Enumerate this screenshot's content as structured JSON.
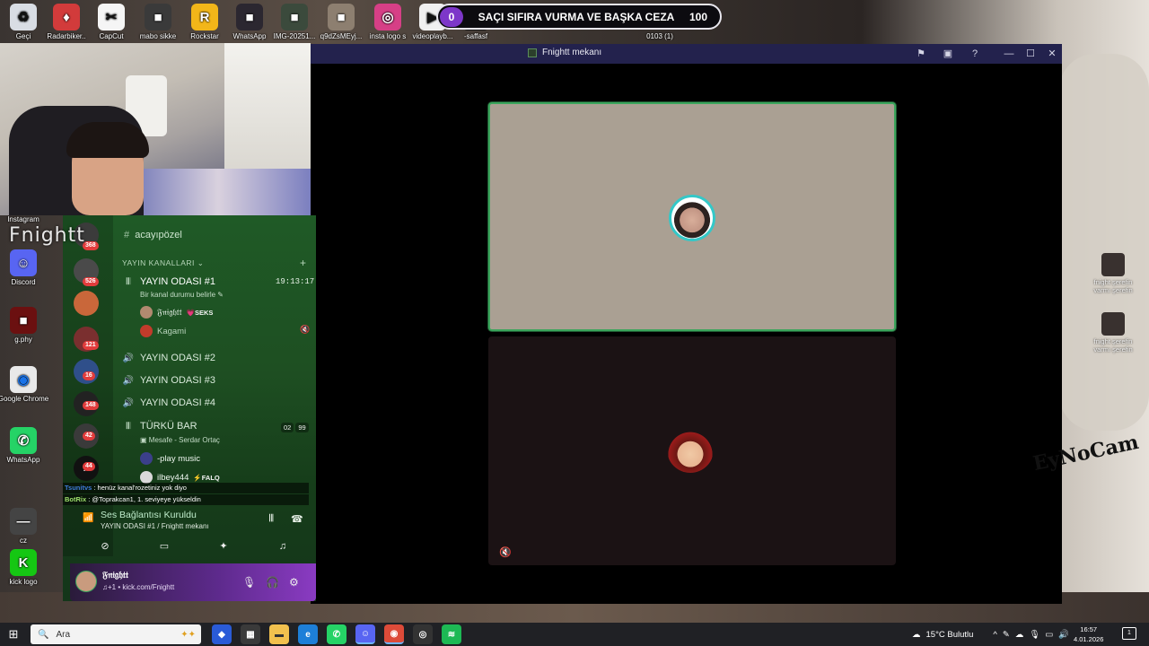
{
  "desktop_icons_top": [
    {
      "label": "Geçi",
      "color": "#d9dde4",
      "glyph": "♻"
    },
    {
      "label": "Radarbiker..",
      "color": "#d23b3b",
      "glyph": "♦"
    },
    {
      "label": "CapCut",
      "color": "#f5f5f5",
      "glyph": "✂"
    },
    {
      "label": "mabo sikke",
      "color": "#3a3a3a",
      "glyph": "■"
    },
    {
      "label": "Rockstar",
      "color": "#f2b619",
      "glyph": "R"
    },
    {
      "label": "WhatsApp",
      "color": "#2b2730",
      "glyph": "■"
    },
    {
      "label": "IMG-20251...",
      "color": "#3b4a3c",
      "glyph": "■"
    },
    {
      "label": "q9dZsMEyj...",
      "color": "#8d7f70",
      "glyph": "■"
    },
    {
      "label": "insta logo s",
      "color": "#d63f86",
      "glyph": "◎"
    },
    {
      "label": "videoplayb...",
      "color": "#f0f0f0",
      "glyph": "▶"
    },
    {
      "label": "-saffasf",
      "color": "#1b1b1b",
      "glyph": "■"
    },
    {
      "label": "0103 (1)",
      "color": "#000000",
      "glyph": ""
    }
  ],
  "desktop_icons_left": [
    {
      "label": "Instagram",
      "color": "#c73a7c",
      "glyph": "◎"
    },
    {
      "label": "Discord",
      "color": "#5865f2",
      "glyph": "☺"
    },
    {
      "label": "g.phy",
      "color": "#6b1010",
      "glyph": "■"
    },
    {
      "label": "Google Chrome",
      "color": "#e9e9e9",
      "glyph": "◉"
    },
    {
      "label": "WhatsApp",
      "color": "#25d366",
      "glyph": "✆"
    },
    {
      "label": "cz",
      "color": "#444444",
      "glyph": "—"
    },
    {
      "label": "kick logo",
      "color": "#15c713",
      "glyph": "K"
    }
  ],
  "score": {
    "left": "0",
    "title": "SAÇI SIFIRA VURMA VE BAŞKA CEZA",
    "right": "100"
  },
  "callwin": {
    "title": "Fnightt mekanı"
  },
  "discord": {
    "streamer": "Fnightt",
    "channel_head": "acayıpözel",
    "category": "YAYIN KANALLARI",
    "active_channel": "YAYIN ODASI #1",
    "timer": "19:13:17",
    "status_hint": "Bir kanal durumu belirle",
    "users_room1": [
      {
        "name": "𝔉𝔫𝔦𝔤𝔥𝔱𝔱",
        "tag": "💗SEKS",
        "color": "#b28a70"
      },
      {
        "name": "Kagami",
        "color": "#c23b2b",
        "tag": ""
      }
    ],
    "channels": [
      "YAYIN ODASI #2",
      "YAYIN ODASI #3",
      "YAYIN ODASI #4"
    ],
    "turku": {
      "name": "TÜRKÜ BAR",
      "sub": "Mesafe - Serdar Ortaç",
      "count_a": "02",
      "count_b": "99"
    },
    "turku_users": [
      {
        "name": "-play music",
        "tag": ""
      },
      {
        "name": "ilbey444",
        "tag": "⚡FALQ"
      }
    ],
    "server_badges": [
      "368",
      "526",
      "121",
      "16",
      "148",
      "42",
      "44"
    ],
    "chat_overlay": [
      {
        "name": "Tsunitvs",
        "text": ": henüz kanal'rozetiniz yok diyo"
      },
      {
        "name": "BotRix",
        "text": ": @Toprakcan1, 1. seviyeye yükseldin"
      }
    ],
    "voice_status": "Ses Bağlantısı Kuruldu",
    "voice_location": "YAYIN ODASI #1 / Fnightt mekanı",
    "user_name": "𝔉𝔫𝔦𝔤𝔥𝔱𝔱",
    "user_status": "♫+1 • kick.com/Fnightt"
  },
  "right_icons": [
    {
      "label": "fnight şerefin varmı şerefin"
    },
    {
      "label": "fnight şerefin varmı şerefin"
    }
  ],
  "signature": "EyNoCam",
  "taskbar": {
    "search_placeholder": "Ara",
    "weather": "15°C  Bulutlu",
    "time": "16:57",
    "date": "4.01.2026",
    "notif": "1"
  }
}
